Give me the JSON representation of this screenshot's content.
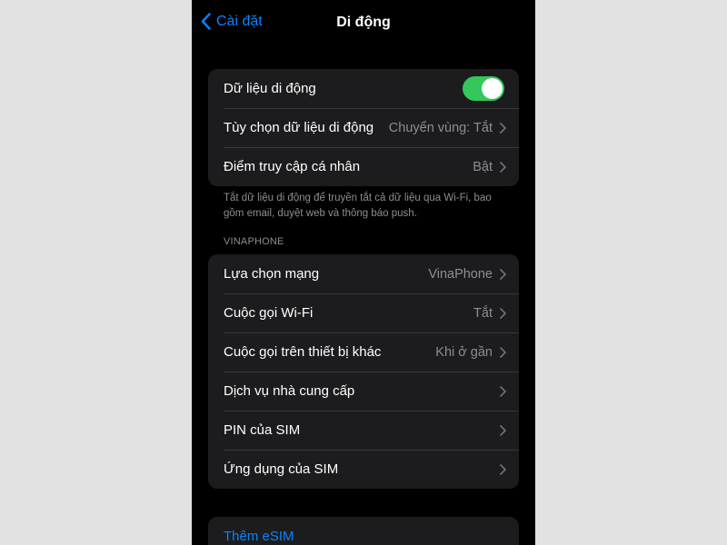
{
  "nav": {
    "back_label": "Cài đặt",
    "title": "Di động"
  },
  "group1": {
    "cellular_data": {
      "label": "Dữ liệu di động",
      "toggle_on": true
    },
    "cellular_options": {
      "label": "Tùy chọn dữ liệu di động",
      "value": "Chuyển vùng: Tắt"
    },
    "hotspot": {
      "label": "Điểm truy cập cá nhân",
      "value": "Bật"
    }
  },
  "footnote": "Tắt dữ liệu di động để truyền tắt cả dữ liệu qua Wi-Fi, bao gồm email, duyệt web và thông báo push.",
  "section_header": "VINAPHONE",
  "group2": {
    "network_selection": {
      "label": "Lựa chọn mạng",
      "value": "VinaPhone"
    },
    "wifi_calling": {
      "label": "Cuộc gọi Wi-Fi",
      "value": "Tắt"
    },
    "other_devices": {
      "label": "Cuộc gọi trên thiết bị khác",
      "value": "Khi ở gần"
    },
    "carrier_services": {
      "label": "Dịch vụ nhà cung cấp"
    },
    "sim_pin": {
      "label": "PIN của SIM"
    },
    "sim_apps": {
      "label": "Ứng dụng của SIM"
    }
  },
  "esim": {
    "label": "Thêm eSIM"
  },
  "colors": {
    "accent": "#0a84ff",
    "toggle_on": "#34c759",
    "background": "#000000",
    "cell_background": "#1c1c1e",
    "secondary_text": "#8e8e93"
  },
  "icons": {
    "back": "chevron-left-icon",
    "disclosure": "chevron-right-icon"
  }
}
